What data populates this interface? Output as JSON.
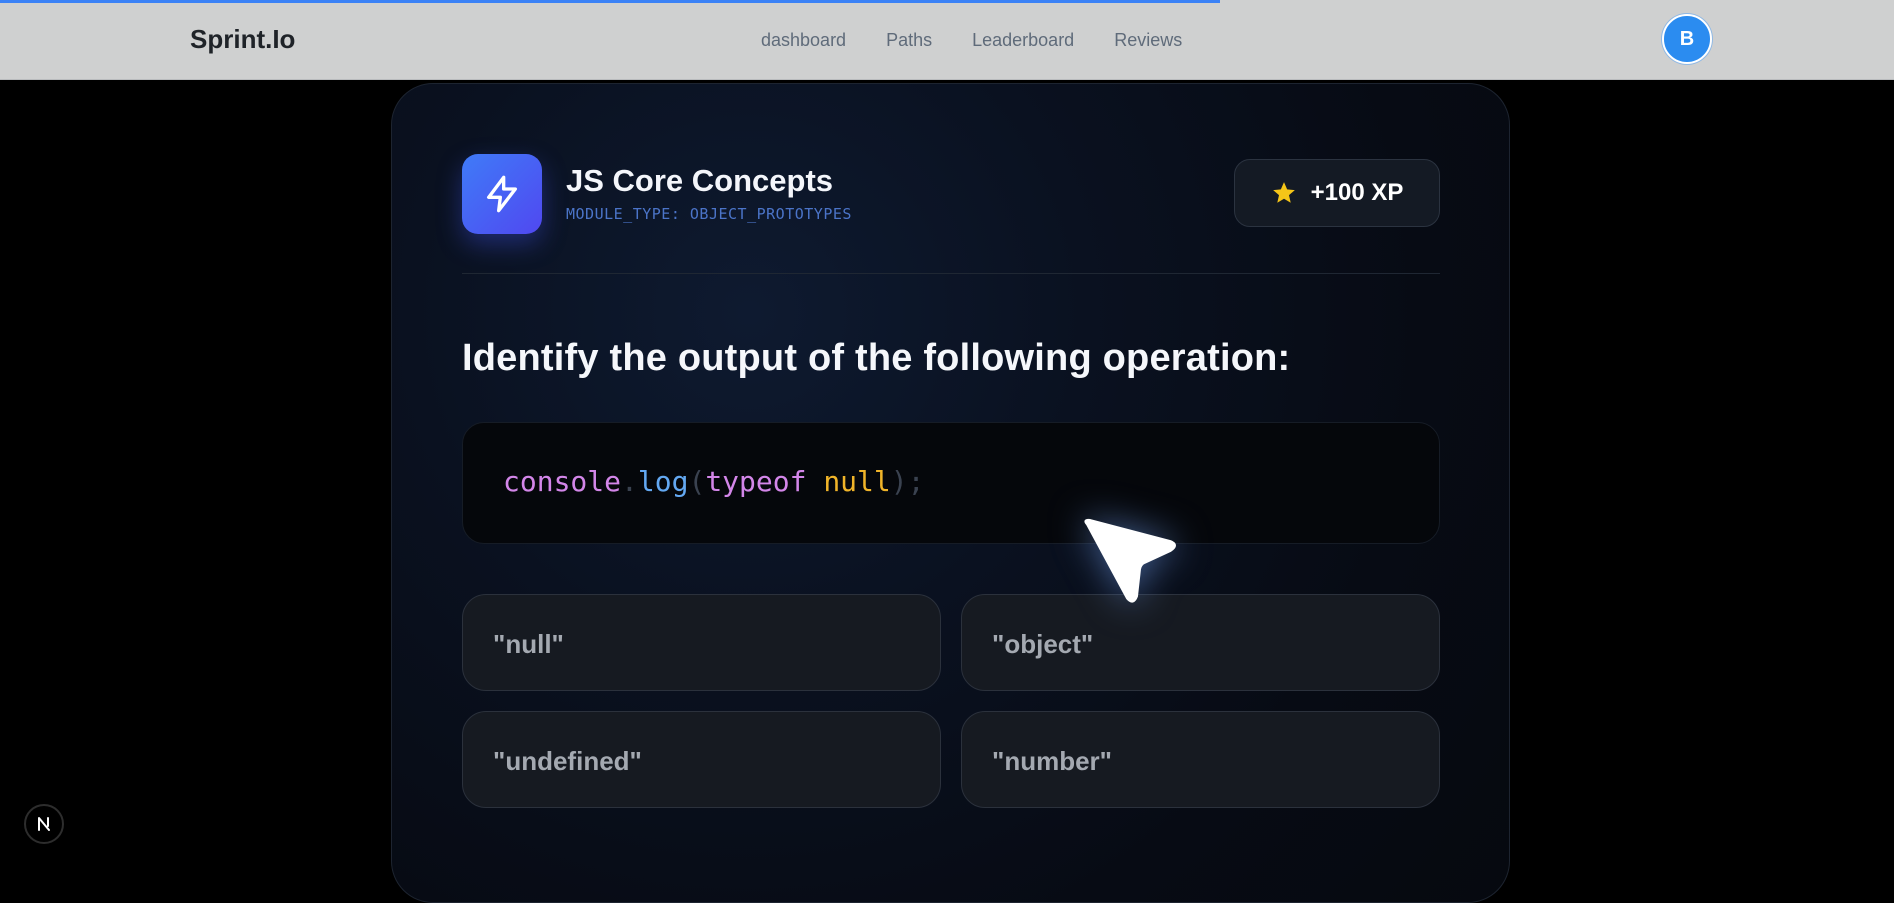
{
  "header": {
    "brand": "Sprint.Io",
    "nav": [
      "dashboard",
      "Paths",
      "Leaderboard",
      "Reviews"
    ],
    "avatar_initial": "B"
  },
  "module": {
    "title": "JS Core Concepts",
    "type_label": "MODULE_TYPE: OBJECT_PROTOTYPES",
    "xp": "+100 XP",
    "icon": "lightning-icon"
  },
  "question": {
    "prompt": "Identify the output of the following operation:",
    "code_tokens": {
      "object": "console",
      "dot": ".",
      "method": "log",
      "open_paren": "(",
      "keyword": "typeof",
      "space": " ",
      "value": "null",
      "close_paren": ")",
      "semicolon": ";"
    },
    "options": [
      "\"null\"",
      "\"object\"",
      "\"undefined\"",
      "\"number\""
    ]
  },
  "colors": {
    "accent": "#3b82f6",
    "xp_star": "#f5c518",
    "code_keyword": "#d386e9",
    "code_method": "#63a8f2",
    "code_value": "#f0b429"
  },
  "dev_badge": "N"
}
